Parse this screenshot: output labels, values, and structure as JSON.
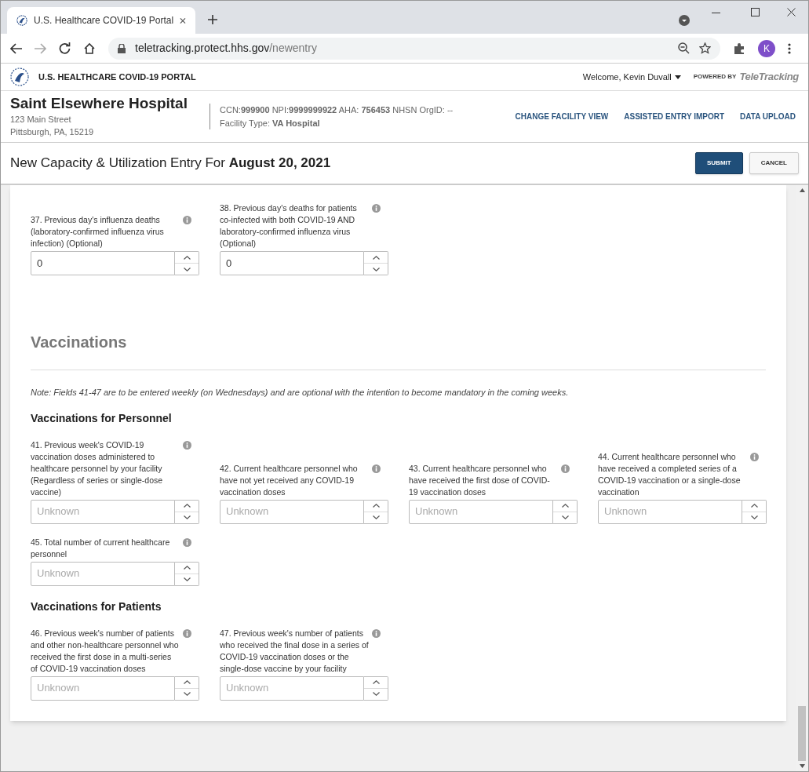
{
  "browser": {
    "tab_title": "U.S. Healthcare COVID-19 Portal",
    "url_host": "teletracking.protect.hhs.gov",
    "url_path": "/newentry",
    "avatar": "K"
  },
  "portal": {
    "title": "U.S. HEALTHCARE COVID-19 PORTAL",
    "welcome": "Welcome, Kevin Duvall",
    "powered_by": "POWERED BY",
    "brand": "TeleTracking"
  },
  "facility": {
    "name": "Saint Elsewhere Hospital",
    "street": "123 Main Street",
    "city": "Pittsburgh, PA, 15219",
    "ids": "CCN:**999900** NPI:**9999999922** AHA: **756453** NHSN OrgID: --",
    "type": "Facility Type: **VA Hospital**",
    "links": [
      "CHANGE FACILITY VIEW",
      "ASSISTED ENTRY IMPORT",
      "DATA UPLOAD"
    ]
  },
  "entry": {
    "title": "New Capacity & Utilization Entry For **August 20, 2021**",
    "buttons": [
      {
        "label": "SUBMIT",
        "kind": "primary"
      },
      {
        "label": "CANCEL",
        "kind": "secondary"
      }
    ]
  },
  "blocks": [
    {
      "kind": "fields",
      "fields": [
        {
          "label": "37. Previous day's influenza deaths (laboratory-confirmed influenza virus infection) (Optional)",
          "value": "0"
        },
        {
          "label": "38. Previous day's deaths for patients co-infected with both COVID-19 AND laboratory-confirmed influenza virus (Optional)",
          "value": "0"
        }
      ]
    },
    {
      "kind": "heading",
      "text": "Vaccinations"
    },
    {
      "kind": "note",
      "text": "Note: Fields 41-47 are to be entered weekly (on Wednesdays) and are optional with the intention to become mandatory in the coming weeks."
    },
    {
      "kind": "subheading",
      "text": "Vaccinations for Personnel"
    },
    {
      "kind": "fields",
      "fields": [
        {
          "label": "41. Previous week's COVID-19 vaccination doses administered to healthcare personnel by your facility (Regardless of series or single-dose vaccine)",
          "placeholder": "Unknown"
        },
        {
          "label": "42. Current healthcare personnel who have not yet received any COVID-19 vaccination doses",
          "placeholder": "Unknown"
        },
        {
          "label": "43. Current healthcare personnel who have received the first dose of COVID-19 vaccination doses",
          "placeholder": "Unknown"
        },
        {
          "label": "44. Current healthcare personnel who have received a completed series of a COVID-19 vaccination or a single-dose vaccination",
          "placeholder": "Unknown"
        }
      ]
    },
    {
      "kind": "fields",
      "fields": [
        {
          "label": "45. Total number of current healthcare personnel",
          "placeholder": "Unknown"
        }
      ]
    },
    {
      "kind": "subheading",
      "text": "Vaccinations for Patients"
    },
    {
      "kind": "fields",
      "fields": [
        {
          "label": "46. Previous week's number of patients and other non-healthcare personnel who received the first dose in a multi-series of COVID-19 vaccination doses",
          "placeholder": "Unknown"
        },
        {
          "label": "47. Previous week's number of patients who received the final dose in a series of COVID-19 vaccination doses or the single-dose vaccine by your facility",
          "placeholder": "Unknown"
        }
      ]
    }
  ]
}
